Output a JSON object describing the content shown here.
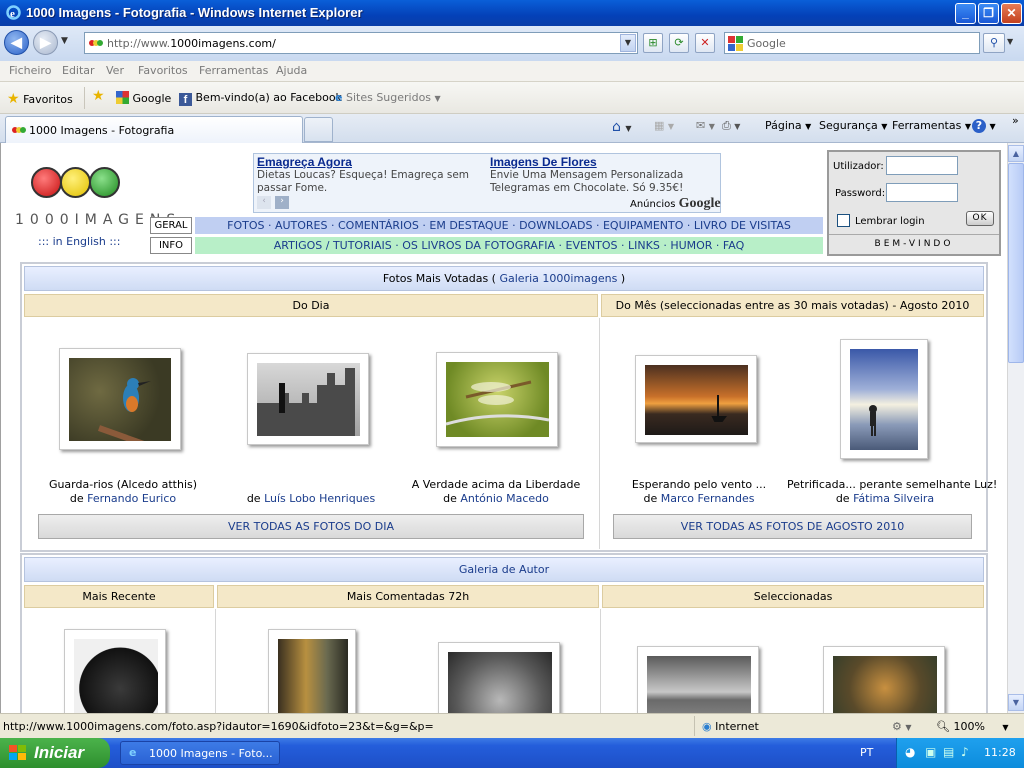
{
  "window": {
    "title": "1000 Imagens - Fotografia - Windows Internet Explorer"
  },
  "address": {
    "prefix": "http://www.",
    "host": "1000imagens.com/",
    "search_placeholder": "Google"
  },
  "menu": [
    "Ficheiro",
    "Editar",
    "Ver",
    "Favoritos",
    "Ferramentas",
    "Ajuda"
  ],
  "favorites": {
    "label": "Favoritos",
    "items": [
      "Google",
      "Bem-vindo(a) ao Facebook",
      "Sites Sugeridos"
    ]
  },
  "tab": {
    "title": "1000 Imagens - Fotografia"
  },
  "commands": [
    "Página",
    "Segurança",
    "Ferramentas"
  ],
  "site": {
    "logo_text": "1000IMAGENS",
    "english_link": "::: in English :::",
    "ads": [
      {
        "title": "Emagreça Agora",
        "text": "Dietas Loucas? Esqueça! Emagreça sem passar Fome."
      },
      {
        "title": "Imagens De Flores",
        "text": "Envie Uma Mensagem Personalizada Telegramas em Chocolate. Só 9.35€!"
      }
    ],
    "ads_label": "Anúncios",
    "ads_brand": "Google",
    "nav": {
      "geral_label": "GERAL",
      "info_label": "INFO",
      "geral": "FOTOS · AUTORES · COMENTÁRIOS · EM DESTAQUE · DOWNLOADS · EQUIPAMENTO · LIVRO DE VISITAS",
      "info": "ARTIGOS / TUTORIAIS · OS LIVROS DA FOTOGRAFIA · EVENTOS · LINKS · HUMOR · FAQ"
    },
    "login": {
      "user_label": "Utilizador:",
      "pass_label": "Password:",
      "remember": "Lembrar login",
      "ok": "OK",
      "welcome": "BEM-VINDO"
    }
  },
  "top_voted": {
    "header_text": "Fotos Mais Votadas (",
    "header_link": "Galeria 1000imagens",
    "header_end": ")",
    "day_header": "Do Dia",
    "month_header": "Do Mês (seleccionadas entre as 30 mais votadas) - Agosto 2010",
    "photos": [
      {
        "title": "Guarda-rios (Alcedo atthis)",
        "by": "de",
        "author": "Fernando Eurico"
      },
      {
        "title": "",
        "by": "de",
        "author": "Luís Lobo Henriques"
      },
      {
        "title": "A Verdade acima da Liberdade",
        "by": "de",
        "author": "António Macedo"
      },
      {
        "title": "Esperando pelo vento ...",
        "by": "de",
        "author": "Marco Fernandes"
      },
      {
        "title": "Petrificada... perante semelhante Luz!",
        "by": "de",
        "author": "Fátima Silveira"
      }
    ],
    "see_day": "VER TODAS AS FOTOS DO DIA",
    "see_month": "VER TODAS AS FOTOS DE AGOSTO 2010"
  },
  "author_gallery": {
    "header": "Galeria de Autor",
    "cols": [
      "Mais Recente",
      "Mais Comentadas 72h",
      "Seleccionadas"
    ]
  },
  "status": {
    "url": "http://www.1000imagens.com/foto.asp?idautor=1690&idfoto=23&t=&g=&p=",
    "zone": "Internet",
    "zoom": "100%"
  },
  "taskbar": {
    "start": "Iniciar",
    "task": "1000 Imagens - Foto...",
    "lang": "PT",
    "clock": "11:28"
  }
}
